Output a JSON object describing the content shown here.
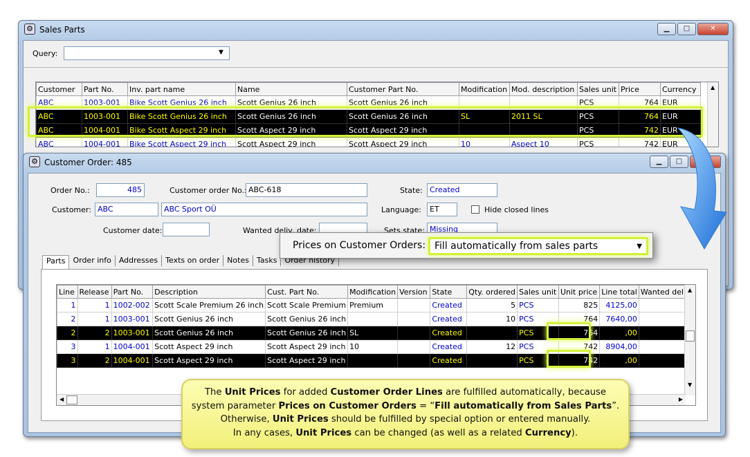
{
  "sales_window": {
    "title": "Sales Parts",
    "query_label": "Query:",
    "query_value": "",
    "columns": [
      "Customer",
      "Part No.",
      "Inv. part name",
      "Name",
      "Customer Part No.",
      "Modification",
      "Mod. description",
      "Sales unit",
      "Price",
      "Currency"
    ],
    "rows": [
      [
        "ABC",
        "1003-001",
        "Bike Scott Genius 26 inch",
        "Scott Genius 26 inch",
        "Scott Genius 26 inch",
        "",
        "",
        "PCS",
        "764",
        "EUR"
      ],
      [
        "ABC",
        "1003-001",
        "Bike Scott Genius 26 inch",
        "Scott Genius 26 inch",
        "Scott Genius 26 inch",
        "SL",
        "2011 SL",
        "PCS",
        "764",
        "EUR"
      ],
      [
        "ABC",
        "1004-001",
        "Bike Scott Aspect 29 inch",
        "Scott Aspect 29 inch",
        "Scott Aspect 29 inch",
        "",
        "",
        "PCS",
        "742",
        "EUR"
      ],
      [
        "ABC",
        "1004-001",
        "Bike Scott Aspect 29 inch",
        "Scott Aspect 29 inch",
        "Scott Aspect 29 inch",
        "10",
        "Aspect 10",
        "PCS",
        "742",
        "EUR"
      ]
    ]
  },
  "order_window": {
    "title": "Customer Order: 485",
    "order_no_label": "Order No.:",
    "order_no": "485",
    "cust_order_no_label": "Customer order No.:",
    "cust_order_no": "ABC-618",
    "state_label": "State:",
    "state": "Created",
    "customer_label": "Customer:",
    "customer": "ABC",
    "customer_name": "ABC Sport OÜ",
    "language_label": "Language:",
    "language": "ET",
    "hide_closed_label": "Hide closed lines",
    "customer_date_label": "Customer date:",
    "wanted_label": "Wanted deliv. date:",
    "sets_state_label": "Sets state:",
    "sets_state": "Missing",
    "tabs": [
      "Parts",
      "Order info",
      "Addresses",
      "Texts on order",
      "Notes",
      "Tasks",
      "Order history"
    ],
    "columns": [
      "Line",
      "Release",
      "Part No.",
      "Description",
      "Cust. Part No.",
      "Modification",
      "Version",
      "State",
      "Qty. ordered",
      "Sales unit",
      "Unit price",
      "Line total",
      "Wanted deliv"
    ],
    "rows": [
      [
        "1",
        "1",
        "1002-002",
        "Scott Scale Premium 26 inch",
        "Scott Scale Premium",
        "Premium",
        "",
        "Created",
        "5",
        "PCS",
        "825",
        "4125,00",
        ""
      ],
      [
        "2",
        "1",
        "1003-001",
        "Scott Genius 26 inch",
        "Scott Genius 26 inch",
        "",
        "",
        "Created",
        "10",
        "PCS",
        "764",
        "7640,00",
        ""
      ],
      [
        "2",
        "2",
        "1003-001",
        "Scott Genius 26 inch",
        "Scott Genius 26 inch",
        "SL",
        "",
        "Created",
        "",
        "PCS",
        "764",
        ",00",
        ""
      ],
      [
        "3",
        "1",
        "1004-001",
        "Scott Aspect 29 inch",
        "Scott Aspect 29 inch",
        "10",
        "",
        "Created",
        "12",
        "PCS",
        "742",
        "8904,00",
        ""
      ],
      [
        "3",
        "2",
        "1004-001",
        "Scott Aspect 29 inch",
        "Scott Aspect 29 inch",
        "",
        "",
        "Created",
        "",
        "PCS",
        "742",
        ",00",
        ""
      ]
    ]
  },
  "popup": {
    "label": "Prices on Customer Orders:",
    "value": "Fill automatically from sales parts"
  },
  "note": {
    "l1a": "The ",
    "l1b": "Unit Prices",
    "l1c": " for added ",
    "l1d": "Customer Order Lines",
    "l1e": " are fulfilled automatically, because",
    "l2a": "system parameter ",
    "l2b": "Prices on Customer Orders",
    "l2c": " = “",
    "l2d": "Fill automatically from Sales Parts",
    "l2e": "”.",
    "l3a": "Otherwise, ",
    "l3b": "Unit Prices",
    "l3c": " should be fulfilled by special option or entered manually.",
    "l4a": "In any cases, ",
    "l4b": "Unit Prices",
    "l4c": " can be changed (as well as a related ",
    "l4d": "Currency",
    "l4e": ")."
  },
  "colors": {
    "highlight": "#d4f03a",
    "note_bg": "#fdfdb4",
    "selected_row": "#000000"
  }
}
